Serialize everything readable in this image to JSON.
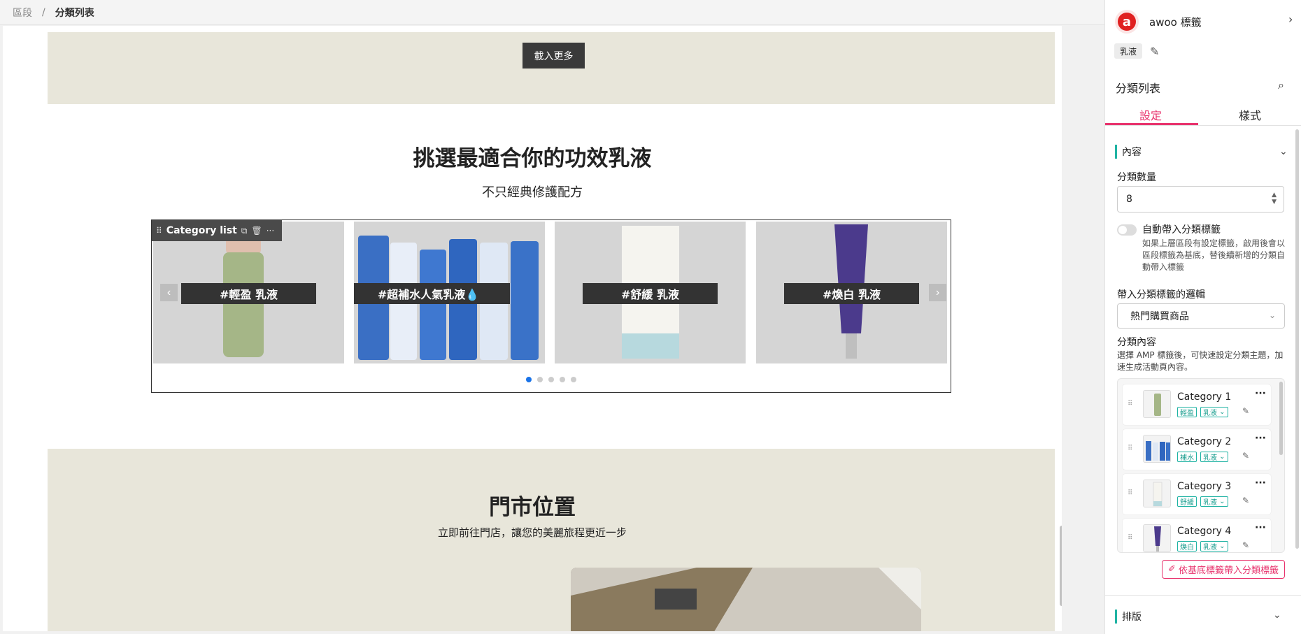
{
  "breadcrumb": {
    "root": "區段",
    "separator": "/",
    "current": "分類列表"
  },
  "canvas": {
    "load_more": "載入更多",
    "section1": {
      "title": "挑選最適合你的功效乳液",
      "subtitle": "不只經典修護配方"
    },
    "widget": {
      "label": "Category list",
      "more": "···"
    },
    "tiles": [
      {
        "label": "#輕盈 乳液"
      },
      {
        "label": "#超補水人氣乳液💧"
      },
      {
        "label": "#舒緩 乳液"
      },
      {
        "label": "#煥白 乳液"
      }
    ],
    "arrows": {
      "prev": "‹",
      "next": "›"
    },
    "dots_count": 5,
    "active_dot": 0,
    "section2": {
      "title": "門市位置",
      "subtitle": "立即前往門店，讓您的美麗旅程更近一步"
    }
  },
  "panel": {
    "brand_name": "awoo 標籤",
    "tag": "乳液",
    "title": "分類列表",
    "tabs": [
      {
        "label": "設定"
      },
      {
        "label": "樣式"
      }
    ],
    "content_section": "內容",
    "count_label": "分類數量",
    "count_value": "8",
    "auto_tag_label": "自動帶入分類標籤",
    "auto_tag_desc": "如果上層區段有設定標籤，啟用後會以區段標籤為基底，替後續新增的分類自動帶入標籤",
    "logic_label": "帶入分類標籤的邏輯",
    "logic_value": "熱門購買商品",
    "content_label": "分類內容",
    "content_desc": "選擇 AMP 標籤後，可快速設定分類主題，加速生成活動頁內容。",
    "categories": [
      {
        "name": "Category 1",
        "tag1": "輕盈",
        "tag2": "乳液"
      },
      {
        "name": "Category 2",
        "tag1": "補水",
        "tag2": "乳液"
      },
      {
        "name": "Category 3",
        "tag1": "舒緩",
        "tag2": "乳液"
      },
      {
        "name": "Category 4",
        "tag1": "煥白",
        "tag2": "乳液"
      }
    ],
    "apply_button": "依基底標籤帶入分類標籤",
    "layout_section": "排版"
  },
  "colors": {
    "accent": "#e8336d",
    "teal": "#1fb3a3",
    "band": "#e8e6da",
    "dark_label": "#333333"
  }
}
